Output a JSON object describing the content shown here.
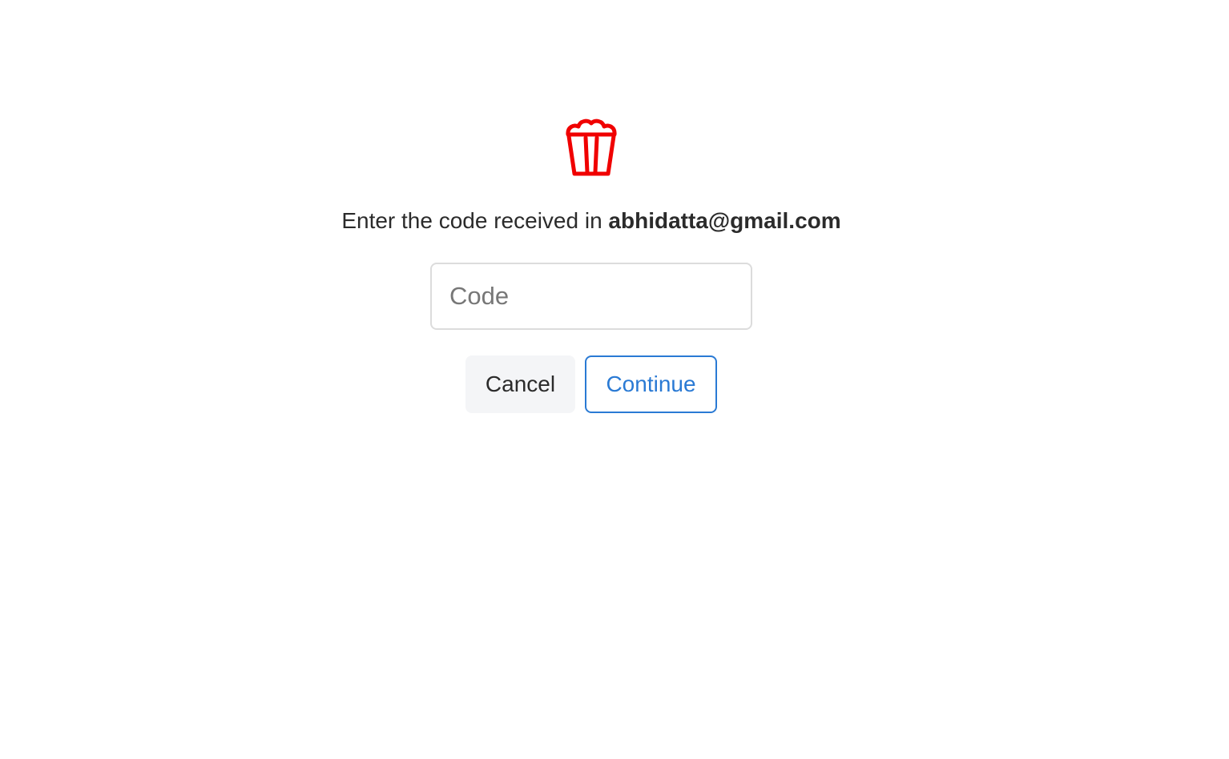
{
  "logo": {
    "icon": "popcorn-icon",
    "color": "#f00000"
  },
  "prompt": {
    "text": "Enter the code received in ",
    "email": "abhidatta@gmail.com"
  },
  "code_input": {
    "value": "",
    "placeholder": "Code"
  },
  "buttons": {
    "cancel_label": "Cancel",
    "continue_label": "Continue"
  },
  "colors": {
    "accent": "#2a7ad4",
    "brand": "#f00000",
    "cancel_bg": "#f4f5f7"
  }
}
